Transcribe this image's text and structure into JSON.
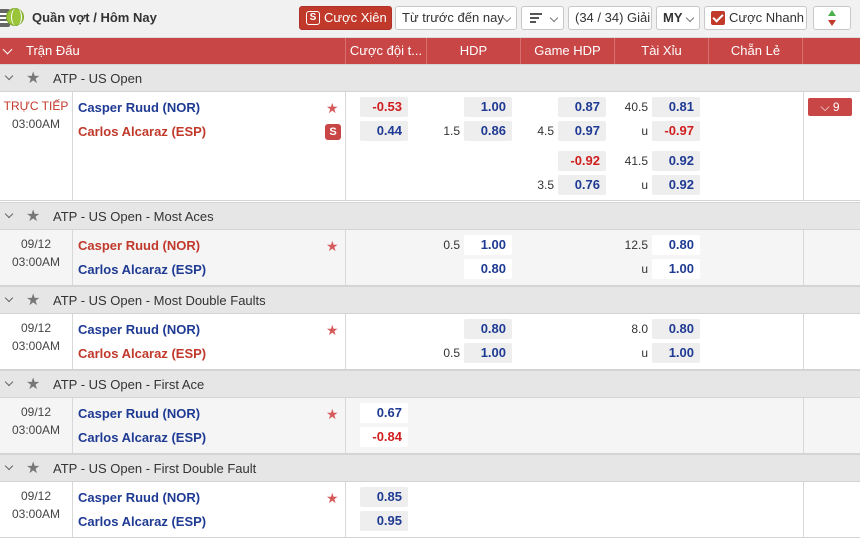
{
  "toolbar": {
    "breadcrumb": "Quần vợt / Hôm Nay",
    "parlay_label": "Cược Xiên",
    "time_filter": "Từ trước đến nay",
    "count_label": "(34 / 34) Giải",
    "odds_type": "MY",
    "quick_bet_label": "Cược Nhanh"
  },
  "columns": {
    "match": "Trận Đấu",
    "winner": "Cược đội t...",
    "hdp": "HDP",
    "game_hdp": "Game HDP",
    "over_under": "Tài Xỉu",
    "odd_even": "Chẵn Lẻ"
  },
  "sections": [
    {
      "title": "ATP - US Open",
      "time_top": "TRỰC TIẾP",
      "time_bottom": "03:00AM",
      "home": "Casper Ruud (NOR)",
      "away": "Carlos Alcaraz (ESP)",
      "winner": [
        "-0.53",
        "0.44"
      ],
      "hdp_line": "1.5",
      "hdp": [
        "1.00",
        "0.86"
      ],
      "game_hdp_line": "4.5",
      "game_hdp": [
        "0.87",
        "0.97"
      ],
      "ou_line": "40.5",
      "ou_under": "u",
      "ou": [
        "0.81",
        "-0.97"
      ],
      "game_hdp_line2": "3.5",
      "game_hdp2": [
        "-0.92",
        "0.76"
      ],
      "ou_line2": "41.5",
      "ou_under2": "u",
      "ou2": [
        "0.92",
        "0.92"
      ],
      "more": "9"
    },
    {
      "title": "ATP - US Open - Most Aces",
      "time_top": "09/12",
      "time_bottom": "03:00AM",
      "home": "Casper Ruud (NOR)",
      "away": "Carlos Alcaraz (ESP)",
      "hdp_line": "0.5",
      "hdp": [
        "1.00",
        "0.80"
      ],
      "ou_line": "12.5",
      "ou_under": "u",
      "ou": [
        "0.80",
        "1.00"
      ]
    },
    {
      "title": "ATP - US Open - Most Double Faults",
      "time_top": "09/12",
      "time_bottom": "03:00AM",
      "home": "Casper Ruud (NOR)",
      "away": "Carlos Alcaraz (ESP)",
      "hdp_line": "0.5",
      "hdp": [
        "0.80",
        "1.00"
      ],
      "ou_line": "8.0",
      "ou_under": "u",
      "ou": [
        "0.80",
        "1.00"
      ]
    },
    {
      "title": "ATP - US Open - First Ace",
      "time_top": "09/12",
      "time_bottom": "03:00AM",
      "home": "Casper Ruud (NOR)",
      "away": "Carlos Alcaraz (ESP)",
      "winner": [
        "0.67",
        "-0.84"
      ]
    },
    {
      "title": "ATP - US Open - First Double Fault",
      "time_top": "09/12",
      "time_bottom": "03:00AM",
      "home": "Casper Ruud (NOR)",
      "away": "Carlos Alcaraz (ESP)",
      "winner": [
        "0.85",
        "0.95"
      ]
    }
  ],
  "icons": {
    "menu": "menu-icon",
    "sport": "tennis-ball-icon",
    "parlay": "parlay-s-icon",
    "favorite": "star-icon",
    "stream": "live-stream-icon"
  },
  "colors": {
    "header_red": "#c94646",
    "odds_blue": "#1f3a93",
    "odds_negative": "#d01e1e"
  }
}
